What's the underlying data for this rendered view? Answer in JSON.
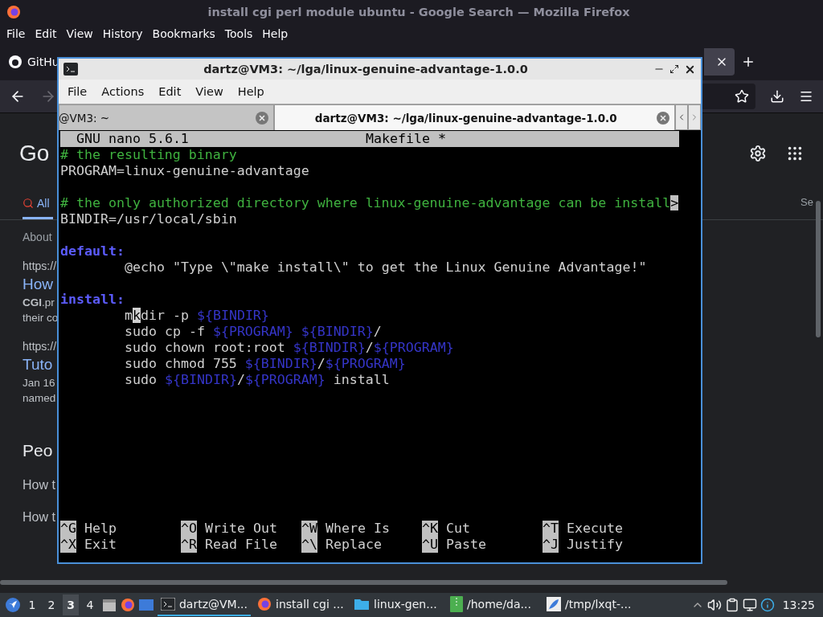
{
  "firefox": {
    "title": "install cgi perl module ubuntu - Google Search — Mozilla Firefox",
    "menu": [
      "File",
      "Edit",
      "View",
      "History",
      "Bookmarks",
      "Tools",
      "Help"
    ],
    "tab": "GitHu",
    "page": {
      "logo": "Go",
      "search_tab": "All",
      "side_text": "Se",
      "results": [
        {
          "kind": "meta",
          "text": "About"
        },
        {
          "kind": "url",
          "text": "https://"
        },
        {
          "kind": "title",
          "text": "How"
        },
        {
          "kind": "snippet",
          "text": "**CGI**.pr"
        },
        {
          "kind": "snippet",
          "text": "their co"
        },
        {
          "kind": "url",
          "text": "https://"
        },
        {
          "kind": "title",
          "text": "Tuto"
        },
        {
          "kind": "snippet",
          "text": "Jan 16"
        },
        {
          "kind": "snippet",
          "text": "named"
        },
        {
          "kind": "heading",
          "text": "Peo"
        },
        {
          "kind": "question",
          "text": "How t"
        },
        {
          "kind": "question",
          "text": "How t"
        }
      ]
    }
  },
  "terminal": {
    "title": "dartz@VM3: ~/lga/linux-genuine-advantage-1.0.0",
    "menu": [
      "File",
      "Actions",
      "Edit",
      "View",
      "Help"
    ],
    "tabs": [
      {
        "label": "@VM3: ~",
        "selected": false
      },
      {
        "label": "dartz@VM3: ~/lga/linux-genuine-advantage-1.0.0",
        "selected": true
      }
    ],
    "nano": {
      "version": "GNU nano 5.6.1",
      "file": "Makefile *",
      "lines": [
        {
          "kind": "code",
          "indented": false,
          "segments": [
            {
              "kind": "comment",
              "text": "# the resulting binary"
            }
          ]
        },
        {
          "kind": "code",
          "indented": false,
          "segments": [
            {
              "kind": "plain",
              "text": "PROGRAM=linux-genuine-advantage"
            }
          ]
        },
        {
          "kind": "blank"
        },
        {
          "kind": "code",
          "indented": false,
          "segments": [
            {
              "kind": "comment",
              "text": "# the only authorized directory where linux-genuine-advantage can be install"
            },
            {
              "kind": "marker",
              "text": ">"
            }
          ]
        },
        {
          "kind": "code",
          "indented": false,
          "segments": [
            {
              "kind": "plain",
              "text": "BINDIR=/usr/local/sbin"
            }
          ]
        },
        {
          "kind": "blank"
        },
        {
          "kind": "code",
          "indented": false,
          "segments": [
            {
              "kind": "label",
              "text": "default:"
            }
          ]
        },
        {
          "kind": "code",
          "indented": true,
          "segments": [
            {
              "kind": "plain",
              "text": "@echo \"Type \\\"make install\\\" to get the Linux Genuine Advantage!\""
            }
          ]
        },
        {
          "kind": "blank"
        },
        {
          "kind": "code",
          "indented": false,
          "segments": [
            {
              "kind": "label",
              "text": "install:"
            }
          ]
        },
        {
          "kind": "code",
          "indented": true,
          "segments": [
            {
              "kind": "plain",
              "text": "m"
            },
            {
              "kind": "cursor",
              "text": "k"
            },
            {
              "kind": "plain",
              "text": "dir -p "
            },
            {
              "kind": "variable",
              "text": "${BINDIR}"
            }
          ]
        },
        {
          "kind": "code",
          "indented": true,
          "segments": [
            {
              "kind": "plain",
              "text": "sudo cp -f "
            },
            {
              "kind": "variable",
              "text": "${PROGRAM} ${BINDIR}"
            },
            {
              "kind": "plain",
              "text": "/"
            }
          ]
        },
        {
          "kind": "code",
          "indented": true,
          "segments": [
            {
              "kind": "plain",
              "text": "sudo chown root:root "
            },
            {
              "kind": "variable",
              "text": "${BINDIR}"
            },
            {
              "kind": "plain",
              "text": "/"
            },
            {
              "kind": "variable",
              "text": "${PROGRAM}"
            }
          ]
        },
        {
          "kind": "code",
          "indented": true,
          "segments": [
            {
              "kind": "plain",
              "text": "sudo chmod 755 "
            },
            {
              "kind": "variable",
              "text": "${BINDIR}"
            },
            {
              "kind": "plain",
              "text": "/"
            },
            {
              "kind": "variable",
              "text": "${PROGRAM}"
            }
          ]
        },
        {
          "kind": "code",
          "indented": true,
          "segments": [
            {
              "kind": "plain",
              "text": "sudo "
            },
            {
              "kind": "variable",
              "text": "${BINDIR}"
            },
            {
              "kind": "plain",
              "text": "/"
            },
            {
              "kind": "variable",
              "text": "${PROGRAM}"
            },
            {
              "kind": "plain",
              "text": " install"
            }
          ]
        }
      ],
      "shortcuts": [
        {
          "key": "^G",
          "label": "Help"
        },
        {
          "key": "^O",
          "label": "Write Out"
        },
        {
          "key": "^W",
          "label": "Where Is"
        },
        {
          "key": "^K",
          "label": "Cut"
        },
        {
          "key": "^T",
          "label": "Execute"
        },
        {
          "key": "^X",
          "label": "Exit"
        },
        {
          "key": "^R",
          "label": "Read File"
        },
        {
          "key": "^\\",
          "label": "Replace"
        },
        {
          "key": "^U",
          "label": "Paste"
        },
        {
          "key": "^J",
          "label": "Justify"
        }
      ]
    }
  },
  "taskbar": {
    "workspaces": [
      {
        "label": "1",
        "selected": false
      },
      {
        "label": "2",
        "selected": false
      },
      {
        "label": "3",
        "selected": true
      },
      {
        "label": "4",
        "selected": false
      }
    ],
    "tasks": [
      {
        "kind": "terminal",
        "label": "dartz@VM...",
        "selected": true
      },
      {
        "kind": "firefox",
        "label": "install cgi ...",
        "selected": false
      },
      {
        "kind": "folder",
        "label": "linux-gen...",
        "selected": false
      },
      {
        "kind": "archive",
        "label": "/home/da...",
        "selected": false
      },
      {
        "kind": "editor",
        "label": "/tmp/lxqt-...",
        "selected": false
      }
    ],
    "clock": "13:25"
  }
}
